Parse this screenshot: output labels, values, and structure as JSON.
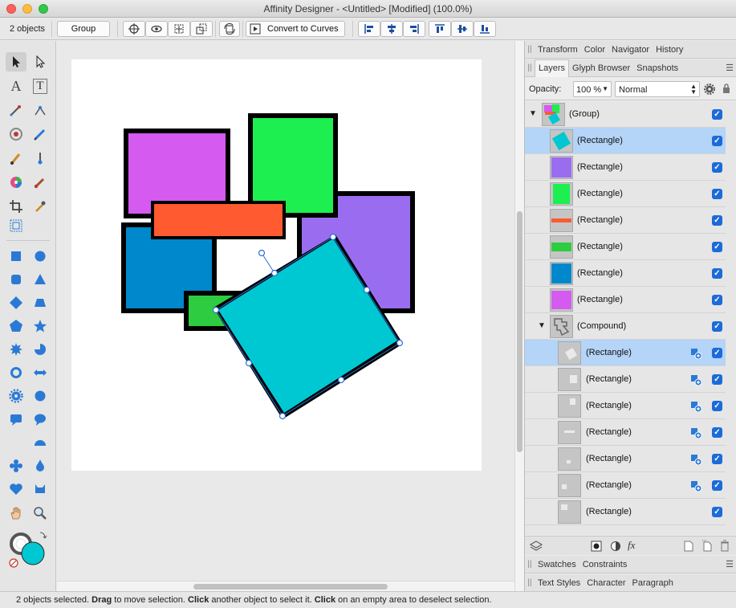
{
  "window": {
    "title": "Affinity Designer - <Untitled> [Modified] (100.0%)"
  },
  "toolbar": {
    "selection_count": "2 objects",
    "group_label": "Group",
    "convert_label": "Convert to Curves"
  },
  "tools": [
    "move-tool",
    "node-tool",
    "artistic-text-tool",
    "frame-text-tool",
    "pen-tool",
    "corner-tool",
    "transparency-tool",
    "pencil-tool",
    "vector-brush-tool",
    "fill-tool",
    "color-picker-tool",
    "paint-brush-tool",
    "crop-tool",
    "place-image-tool",
    "rectangle-tool",
    "ellipse-tool",
    "rounded-rectangle-tool",
    "triangle-tool",
    "diamond-tool",
    "trapezoid-tool",
    "pentagon-tool",
    "star-tool",
    "burst-tool",
    "pie-tool",
    "donut-tool",
    "double-arrow-tool",
    "cog-tool",
    "cloud-tool",
    "callout-rounded-tool",
    "callout-ellipse-tool",
    "crescent-tool",
    "segment-tool",
    "flower-tool",
    "tear-tool",
    "heart-tool",
    "cat-tool",
    "hand-tool",
    "zoom-tool"
  ],
  "colors": {
    "fill": "#00c8d2",
    "accent": "#1c6bd8",
    "selection": "#b4d4f8"
  },
  "panels": {
    "top_tabs": [
      "Transform",
      "Color",
      "Navigator",
      "History"
    ],
    "layer_tabs": [
      "Layers",
      "Glyph Browser",
      "Snapshots"
    ],
    "opacity_label": "Opacity:",
    "opacity_value": "100 %",
    "blend_mode": "Normal",
    "swatches_tabs": [
      "Swatches",
      "Constraints"
    ],
    "text_tabs": [
      "Text Styles",
      "Character",
      "Paragraph"
    ]
  },
  "layers": {
    "group": "(Group)",
    "rect": "(Rectangle)",
    "compound": "(Compound)"
  },
  "status": {
    "p1": "2 objects selected. ",
    "b1": "Drag",
    "p2": " to move selection. ",
    "b2": "Click",
    "p3": " another object to select it. ",
    "b3": "Click",
    "p4": " on an empty area to deselect selection."
  }
}
